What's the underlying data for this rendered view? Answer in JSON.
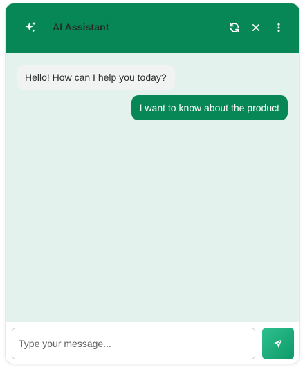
{
  "header": {
    "title": "AI Assistant",
    "icons": {
      "assistant": "sparkles-icon",
      "refresh": "refresh-icon",
      "close": "close-icon",
      "menu": "more-vertical-icon"
    }
  },
  "messages": [
    {
      "role": "assistant",
      "text": "Hello! How can I help you today?"
    },
    {
      "role": "user",
      "text": "I want to know about the product"
    }
  ],
  "composer": {
    "placeholder": "Type your message...",
    "value": "",
    "send_icon": "send-icon"
  },
  "colors": {
    "brand": "#078656",
    "chat_background": "#e3f2ec",
    "bot_bubble": "#f1f3f2",
    "send_gradient_start": "#2ec08f",
    "send_gradient_end": "#0f9a68"
  }
}
